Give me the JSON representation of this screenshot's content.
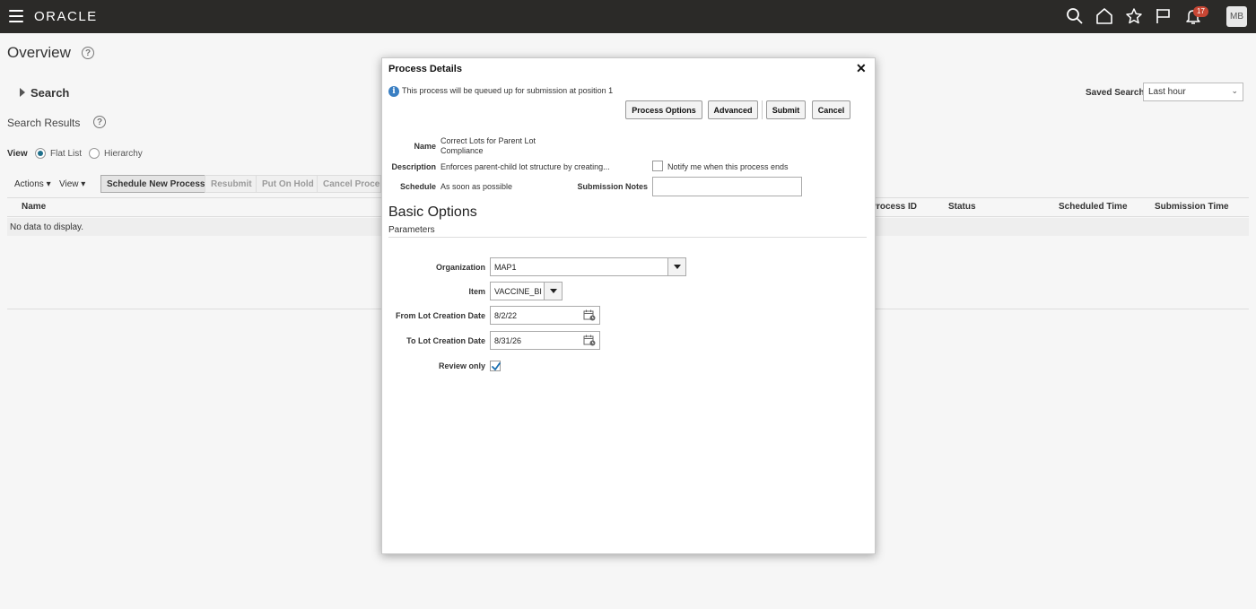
{
  "topbar": {
    "logo": "ORACLE",
    "notification_count": "17",
    "avatar_initials": "MB",
    "icons": [
      "search-icon",
      "home-icon",
      "star-icon",
      "flag-icon",
      "bell-icon"
    ]
  },
  "page": {
    "title": "Overview",
    "search_label": "Search",
    "saved_search_label": "Saved Search",
    "saved_search_value": "Last hour",
    "results_label": "Search Results",
    "view_label": "View",
    "view_options": [
      "Flat List",
      "Hierarchy"
    ],
    "actions_label": "Actions",
    "view_menu_label": "View",
    "toolbar_buttons": [
      "Schedule New Process",
      "Resubmit",
      "Put On Hold",
      "Cancel Process"
    ],
    "columns": [
      "Name",
      "Process ID",
      "Status",
      "Scheduled Time",
      "Submission Time"
    ],
    "no_data": "No data to display."
  },
  "dialog": {
    "title": "Process Details",
    "info": "This process will be queued up for submission at position 1",
    "buttons": {
      "process_options": "Process Options",
      "advanced": "Advanced",
      "submit": "Submit",
      "cancel": "Cancel"
    },
    "name_label": "Name",
    "name_value_line1": "Correct Lots for Parent Lot",
    "name_value_line2": "Compliance",
    "description_label": "Description",
    "description_value": "Enforces parent-child lot structure by creating...",
    "notify_label": "Notify me when this process ends",
    "schedule_label": "Schedule",
    "schedule_value": "As soon as possible",
    "submission_notes_label": "Submission Notes",
    "submission_notes_value": "",
    "section_title": "Basic Options",
    "section_subtitle": "Parameters",
    "params": {
      "organization_label": "Organization",
      "organization_value": "MAP1",
      "item_label": "Item",
      "item_value": "VACCINE_BI",
      "from_date_label": "From Lot Creation Date",
      "from_date_value": "8/2/22",
      "to_date_label": "To Lot Creation Date",
      "to_date_value": "8/31/26",
      "review_only_label": "Review only",
      "review_only_checked": true
    }
  },
  "colors": {
    "topbar": "#2b2a28",
    "badge": "#c74634",
    "radio_accent": "#1f6f8b",
    "info_blue": "#3a7fc3"
  }
}
